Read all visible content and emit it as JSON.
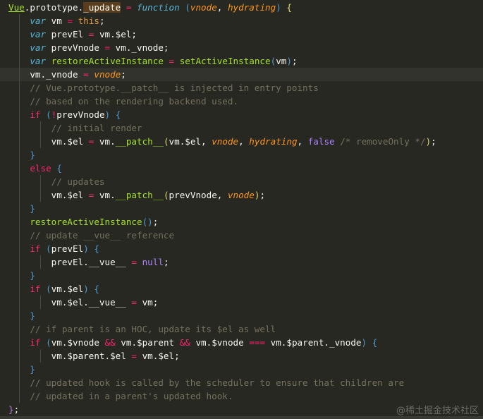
{
  "colors": {
    "background": "#272822",
    "keyword": "#59b7d9",
    "operator": "#f92672",
    "param": "#fd971f",
    "function": "#a6e22e",
    "comment": "#75715e",
    "constant": "#ae81ff"
  },
  "current_line": 5,
  "watermark": "@稀土掘金技术社区",
  "lines": [
    {
      "indent": 0,
      "tokens": [
        [
          "u",
          "Vue"
        ],
        [
          "p",
          ".prototype."
        ],
        [
          "hl",
          "_update"
        ],
        [
          "p",
          " "
        ],
        [
          "r",
          "="
        ],
        [
          "p",
          " "
        ],
        [
          "k",
          "function"
        ],
        [
          "p",
          " "
        ],
        [
          "b1",
          "("
        ],
        [
          "a",
          "vnode"
        ],
        [
          "p",
          ", "
        ],
        [
          "a",
          "hydrating"
        ],
        [
          "b1",
          ")"
        ],
        [
          "p",
          " "
        ],
        [
          "b2",
          "{"
        ]
      ]
    },
    {
      "indent": 1,
      "tokens": [
        [
          "k",
          "var"
        ],
        [
          "p",
          " vm "
        ],
        [
          "r",
          "="
        ],
        [
          "p",
          " "
        ],
        [
          "t",
          "this"
        ],
        [
          "p",
          ";"
        ]
      ]
    },
    {
      "indent": 1,
      "tokens": [
        [
          "k",
          "var"
        ],
        [
          "p",
          " prevEl "
        ],
        [
          "r",
          "="
        ],
        [
          "p",
          " vm.$el;"
        ]
      ]
    },
    {
      "indent": 1,
      "tokens": [
        [
          "k",
          "var"
        ],
        [
          "p",
          " prevVnode "
        ],
        [
          "r",
          "="
        ],
        [
          "p",
          " vm._vnode;"
        ]
      ]
    },
    {
      "indent": 1,
      "tokens": [
        [
          "k",
          "var"
        ],
        [
          "p",
          " "
        ],
        [
          "f",
          "restoreActiveInstance"
        ],
        [
          "p",
          " "
        ],
        [
          "r",
          "="
        ],
        [
          "p",
          " "
        ],
        [
          "f",
          "setActiveInstance"
        ],
        [
          "b1",
          "("
        ],
        [
          "p",
          "vm"
        ],
        [
          "b1",
          ")"
        ],
        [
          "p",
          ";"
        ]
      ]
    },
    {
      "indent": 1,
      "tokens": [
        [
          "p",
          "vm._vnode "
        ],
        [
          "r",
          "="
        ],
        [
          "p",
          " "
        ],
        [
          "a",
          "vnode"
        ],
        [
          "p",
          ";"
        ]
      ]
    },
    {
      "indent": 1,
      "tokens": [
        [
          "c",
          "// Vue.prototype.__patch__ is injected in entry points"
        ]
      ]
    },
    {
      "indent": 1,
      "tokens": [
        [
          "c",
          "// based on the rendering backend used."
        ]
      ]
    },
    {
      "indent": 1,
      "tokens": [
        [
          "r",
          "if"
        ],
        [
          "p",
          " "
        ],
        [
          "b1",
          "("
        ],
        [
          "r",
          "!"
        ],
        [
          "p",
          "prevVnode"
        ],
        [
          "b1",
          ")"
        ],
        [
          "p",
          " "
        ],
        [
          "b1",
          "{"
        ]
      ]
    },
    {
      "indent": 2,
      "tokens": [
        [
          "c",
          "// initial render"
        ]
      ]
    },
    {
      "indent": 2,
      "tokens": [
        [
          "p",
          "vm.$el "
        ],
        [
          "r",
          "="
        ],
        [
          "p",
          " vm."
        ],
        [
          "f",
          "__patch__"
        ],
        [
          "b2",
          "("
        ],
        [
          "p",
          "vm.$el, "
        ],
        [
          "a",
          "vnode"
        ],
        [
          "p",
          ", "
        ],
        [
          "a",
          "hydrating"
        ],
        [
          "p",
          ", "
        ],
        [
          "n",
          "false"
        ],
        [
          "p",
          " "
        ],
        [
          "c",
          "/* removeOnly */"
        ],
        [
          "b2",
          ")"
        ],
        [
          "p",
          ";"
        ]
      ]
    },
    {
      "indent": 1,
      "tokens": [
        [
          "b1",
          "}"
        ]
      ]
    },
    {
      "indent": 1,
      "tokens": [
        [
          "r",
          "else"
        ],
        [
          "p",
          " "
        ],
        [
          "b1",
          "{"
        ]
      ]
    },
    {
      "indent": 2,
      "tokens": [
        [
          "c",
          "// updates"
        ]
      ]
    },
    {
      "indent": 2,
      "tokens": [
        [
          "p",
          "vm.$el "
        ],
        [
          "r",
          "="
        ],
        [
          "p",
          " vm."
        ],
        [
          "f",
          "__patch__"
        ],
        [
          "b2",
          "("
        ],
        [
          "p",
          "prevVnode, "
        ],
        [
          "a",
          "vnode"
        ],
        [
          "b2",
          ")"
        ],
        [
          "p",
          ";"
        ]
      ]
    },
    {
      "indent": 1,
      "tokens": [
        [
          "b1",
          "}"
        ]
      ]
    },
    {
      "indent": 1,
      "tokens": [
        [
          "f",
          "restoreActiveInstance"
        ],
        [
          "b1",
          "()"
        ],
        [
          "p",
          ";"
        ]
      ]
    },
    {
      "indent": 1,
      "tokens": [
        [
          "c",
          "// update __vue__ reference"
        ]
      ]
    },
    {
      "indent": 1,
      "tokens": [
        [
          "r",
          "if"
        ],
        [
          "p",
          " "
        ],
        [
          "b1",
          "("
        ],
        [
          "p",
          "prevEl"
        ],
        [
          "b1",
          ")"
        ],
        [
          "p",
          " "
        ],
        [
          "b1",
          "{"
        ]
      ]
    },
    {
      "indent": 2,
      "tokens": [
        [
          "p",
          "prevEl.__vue__ "
        ],
        [
          "r",
          "="
        ],
        [
          "p",
          " "
        ],
        [
          "n",
          "null"
        ],
        [
          "p",
          ";"
        ]
      ]
    },
    {
      "indent": 1,
      "tokens": [
        [
          "b1",
          "}"
        ]
      ]
    },
    {
      "indent": 1,
      "tokens": [
        [
          "r",
          "if"
        ],
        [
          "p",
          " "
        ],
        [
          "b1",
          "("
        ],
        [
          "p",
          "vm.$el"
        ],
        [
          "b1",
          ")"
        ],
        [
          "p",
          " "
        ],
        [
          "b1",
          "{"
        ]
      ]
    },
    {
      "indent": 2,
      "tokens": [
        [
          "p",
          "vm.$el.__vue__ "
        ],
        [
          "r",
          "="
        ],
        [
          "p",
          " vm;"
        ]
      ]
    },
    {
      "indent": 1,
      "tokens": [
        [
          "b1",
          "}"
        ]
      ]
    },
    {
      "indent": 1,
      "tokens": [
        [
          "c",
          "// if parent is an HOC, update its $el as well"
        ]
      ]
    },
    {
      "indent": 1,
      "tokens": [
        [
          "r",
          "if"
        ],
        [
          "p",
          " "
        ],
        [
          "b1",
          "("
        ],
        [
          "p",
          "vm.$vnode "
        ],
        [
          "r",
          "&&"
        ],
        [
          "p",
          " vm.$parent "
        ],
        [
          "r",
          "&&"
        ],
        [
          "p",
          " vm.$vnode "
        ],
        [
          "r",
          "==="
        ],
        [
          "p",
          " vm.$parent._vnode"
        ],
        [
          "b1",
          ")"
        ],
        [
          "p",
          " "
        ],
        [
          "b1",
          "{"
        ]
      ]
    },
    {
      "indent": 2,
      "tokens": [
        [
          "p",
          "vm.$parent.$el "
        ],
        [
          "r",
          "="
        ],
        [
          "p",
          " vm.$el;"
        ]
      ]
    },
    {
      "indent": 1,
      "tokens": [
        [
          "b1",
          "}"
        ]
      ]
    },
    {
      "indent": 1,
      "tokens": [
        [
          "c",
          "// updated hook is called by the scheduler to ensure that children are"
        ]
      ]
    },
    {
      "indent": 1,
      "tokens": [
        [
          "c",
          "// updated in a parent's updated hook."
        ]
      ]
    },
    {
      "indent": 0,
      "tokens": [
        [
          "b0",
          "}"
        ],
        [
          "p",
          ";"
        ]
      ]
    }
  ]
}
